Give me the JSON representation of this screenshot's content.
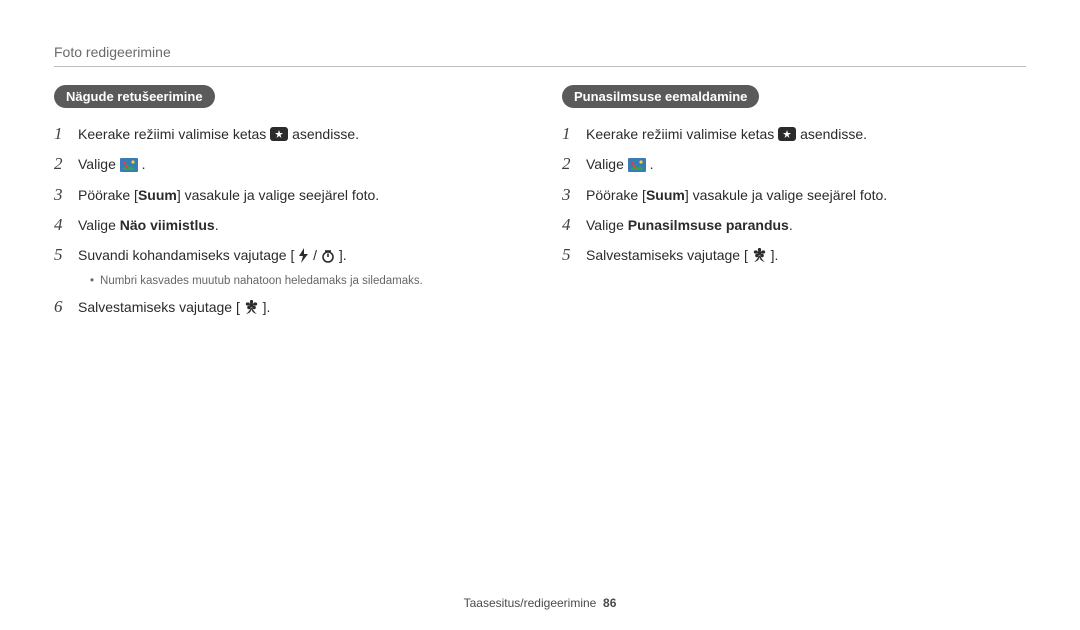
{
  "page": {
    "header": "Foto redigeerimine",
    "footer_section": "Taasesitus/redigeerimine",
    "footer_page": "86"
  },
  "left": {
    "pill": "Nägude retušeerimine",
    "steps": {
      "s1a": "Keerake režiimi valimise ketas ",
      "s1b": " asendisse.",
      "s2a": "Valige ",
      "s2b": ".",
      "s3a": "Pöörake [",
      "s3bold": "Suum",
      "s3b": "] vasakule ja valige seejärel foto.",
      "s4a": "Valige ",
      "s4bold": "Näo viimistlus",
      "s4b": ".",
      "s5a": "Suvandi kohandamiseks vajutage [",
      "s5b": "/",
      "s5c": "].",
      "s5note": "Numbri kasvades muutub nahatoon heledamaks ja siledamaks.",
      "s6a": "Salvestamiseks vajutage [",
      "s6b": "]."
    }
  },
  "right": {
    "pill": "Punasilmsuse eemaldamine",
    "steps": {
      "s1a": "Keerake režiimi valimise ketas ",
      "s1b": " asendisse.",
      "s2a": "Valige ",
      "s2b": ".",
      "s3a": "Pöörake [",
      "s3bold": "Suum",
      "s3b": "] vasakule ja valige seejärel foto.",
      "s4a": "Valige ",
      "s4bold": "Punasilmsuse parandus",
      "s4b": ".",
      "s5a": "Salvestamiseks vajutage [",
      "s5b": "]."
    }
  },
  "icons": {
    "mode": "mode-dial-magic-icon",
    "edit": "edit-photo-icon",
    "flash": "flash-icon",
    "timer": "self-timer-icon",
    "flower": "macro-flower-icon"
  }
}
